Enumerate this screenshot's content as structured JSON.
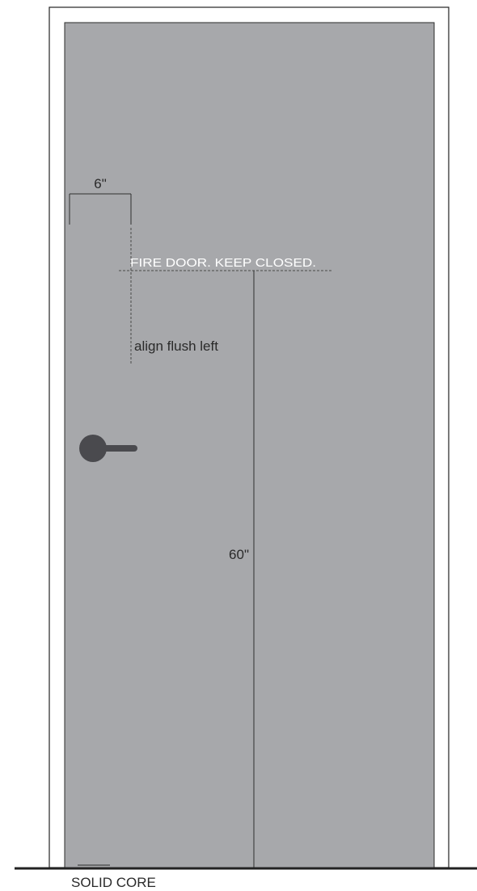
{
  "colors": {
    "background": "#ffffff",
    "frame_stroke": "#222222",
    "door_panel": "#a7a8ab",
    "door_outline": "#2a2a2a",
    "dimension_line": "#2f2f2f",
    "dashed_line": "#4a4a4a",
    "sign_text": "#ffffff",
    "label_text": "#2a2a2a",
    "handle": "#4a4a4e",
    "floor_line": "#222222"
  },
  "labels": {
    "width_dimension": "6\"",
    "sign_text": "FIRE DOOR. KEEP CLOSED.",
    "alignment_note": "align flush left",
    "height_dimension": "60\"",
    "door_type": "SOLID CORE"
  },
  "icons": {
    "handle": "lever-handle-icon"
  }
}
